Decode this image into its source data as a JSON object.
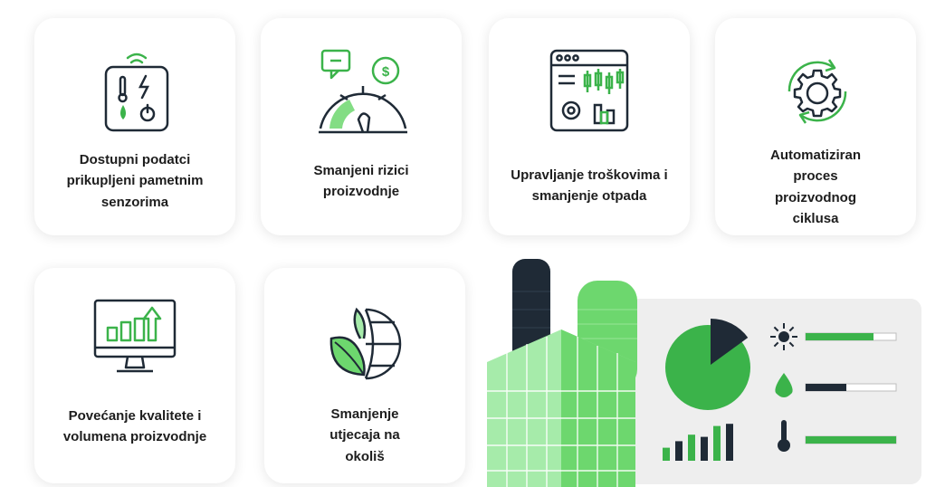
{
  "colors": {
    "dark_navy": "#1f2a36",
    "green": "#3bb34a",
    "light_green": "#6dd76e",
    "pale_green": "#a6ebaa"
  },
  "cards": [
    {
      "id": "sensors",
      "icon": "sensor-device-icon",
      "label": "Dostupni podatci prikupljeni pametnim senzorima"
    },
    {
      "id": "risks",
      "icon": "risk-gauge-icon",
      "label": "Smanjeni rizici proizvodnje"
    },
    {
      "id": "costs",
      "icon": "dashboard-cost-icon",
      "label": "Upravljanje troškovima i smanjenje otpada"
    },
    {
      "id": "automation",
      "icon": "gear-cycle-icon",
      "label": "Automatiziran proces proizvodnog ciklusa"
    },
    {
      "id": "quality",
      "icon": "monitor-growth-icon",
      "label": "Povećanje kvalitete i volumena proizvodnje"
    },
    {
      "id": "environment",
      "icon": "leaf-globe-icon",
      "label": "Smanjenje utjecaja na okoliš"
    }
  ],
  "illustration": {
    "icon": "smart-factory-dashboard-illustration",
    "pie_share_dark": 0.15,
    "bars": [
      0.3,
      0.45,
      0.6,
      0.55,
      0.8,
      0.85
    ],
    "indicators": [
      {
        "icon": "sun-icon",
        "level": 0.75
      },
      {
        "icon": "water-drop-icon",
        "level": 0.45
      },
      {
        "icon": "thermometer-icon",
        "level": 1.0
      }
    ]
  }
}
